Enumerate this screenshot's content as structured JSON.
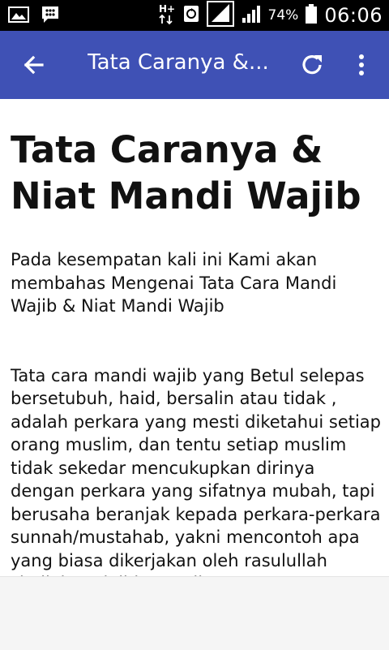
{
  "status_bar": {
    "icons_left": [
      "image-icon",
      "messenger-icon"
    ],
    "network_label": "H+",
    "battery_percent": "74%",
    "time": "06:06"
  },
  "app_bar": {
    "title": "Tata Caranya &...",
    "background_color": "#3f51b5"
  },
  "article": {
    "title": "Tata Caranya & Niat Mandi Wajib",
    "paragraphs": [
      "Pada kesempatan kali ini Kami akan membahas Mengenai Tata Cara Mandi Wajib & Niat Mandi Wajib",
      "Tata cara mandi wajib yang Betul selepas bersetubuh, haid, bersalin atau tidak , adalah perkara yang mesti diketahui setiap orang muslim, dan tentu setiap muslim tidak sekedar mencukupkan dirinya dengan perkara yang sifatnya mubah, tapi berusaha beranjak kepada perkara-perkara sunnah/mustahab, yakni mencontoh apa yang biasa dikerjakan oleh rasulullah shallahu ‘alaihi wa sallam"
    ]
  }
}
